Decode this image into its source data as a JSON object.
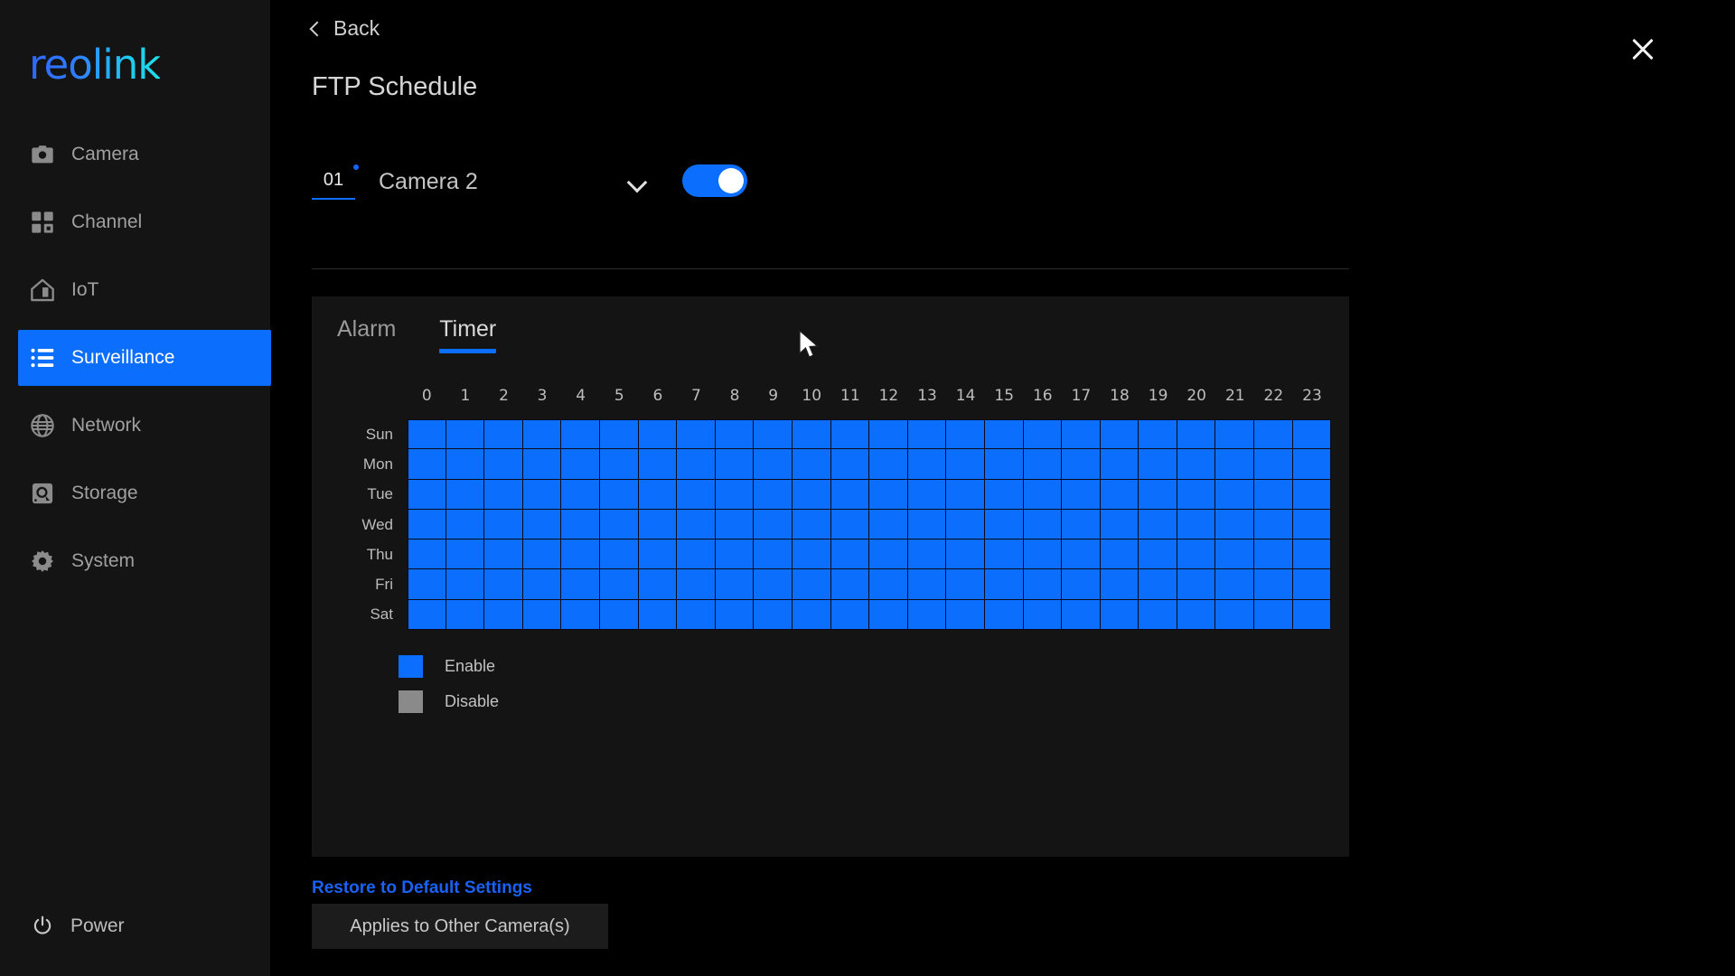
{
  "brand": {
    "logo_text": "reolink"
  },
  "sidebar": {
    "items": [
      {
        "label": "Camera",
        "icon": "camera-icon",
        "active": false
      },
      {
        "label": "Channel",
        "icon": "grid-icon",
        "active": false
      },
      {
        "label": "IoT",
        "icon": "home-icon",
        "active": false
      },
      {
        "label": "Surveillance",
        "icon": "list-icon",
        "active": true
      },
      {
        "label": "Network",
        "icon": "globe-icon",
        "active": false
      },
      {
        "label": "Storage",
        "icon": "hard-drive-icon",
        "active": false
      },
      {
        "label": "System",
        "icon": "gear-icon",
        "active": false
      }
    ],
    "power": {
      "label": "Power",
      "icon": "power-icon"
    }
  },
  "header": {
    "back_label": "Back",
    "back_icon": "chevron-left-icon",
    "title": "FTP Schedule",
    "close_icon": "close-icon"
  },
  "camera_selector": {
    "index": "01",
    "name": "Camera 2",
    "caret_icon": "chevron-down-icon",
    "enabled": true
  },
  "panel": {
    "tabs": [
      {
        "label": "Alarm",
        "active": false
      },
      {
        "label": "Timer",
        "active": true
      }
    ]
  },
  "schedule": {
    "hours": [
      "0",
      "1",
      "2",
      "3",
      "4",
      "5",
      "6",
      "7",
      "8",
      "9",
      "10",
      "11",
      "12",
      "13",
      "14",
      "15",
      "16",
      "17",
      "18",
      "19",
      "20",
      "21",
      "22",
      "23"
    ],
    "days": [
      "Sun",
      "Mon",
      "Tue",
      "Wed",
      "Thu",
      "Fri",
      "Sat"
    ],
    "cells": [
      [
        1,
        1,
        1,
        1,
        1,
        1,
        1,
        1,
        1,
        1,
        1,
        1,
        1,
        1,
        1,
        1,
        1,
        1,
        1,
        1,
        1,
        1,
        1,
        1
      ],
      [
        1,
        1,
        1,
        1,
        1,
        1,
        1,
        1,
        1,
        1,
        1,
        1,
        1,
        1,
        1,
        1,
        1,
        1,
        1,
        1,
        1,
        1,
        1,
        1
      ],
      [
        1,
        1,
        1,
        1,
        1,
        1,
        1,
        1,
        1,
        1,
        1,
        1,
        1,
        1,
        1,
        1,
        1,
        1,
        1,
        1,
        1,
        1,
        1,
        1
      ],
      [
        1,
        1,
        1,
        1,
        1,
        1,
        1,
        1,
        1,
        1,
        1,
        1,
        1,
        1,
        1,
        1,
        1,
        1,
        1,
        1,
        1,
        1,
        1,
        1
      ],
      [
        1,
        1,
        1,
        1,
        1,
        1,
        1,
        1,
        1,
        1,
        1,
        1,
        1,
        1,
        1,
        1,
        1,
        1,
        1,
        1,
        1,
        1,
        1,
        1
      ],
      [
        1,
        1,
        1,
        1,
        1,
        1,
        1,
        1,
        1,
        1,
        1,
        1,
        1,
        1,
        1,
        1,
        1,
        1,
        1,
        1,
        1,
        1,
        1,
        1
      ],
      [
        1,
        1,
        1,
        1,
        1,
        1,
        1,
        1,
        1,
        1,
        1,
        1,
        1,
        1,
        1,
        1,
        1,
        1,
        1,
        1,
        1,
        1,
        1,
        1
      ]
    ],
    "legend": [
      {
        "label": "Enable",
        "state": "on"
      },
      {
        "label": "Disable",
        "state": "off"
      }
    ]
  },
  "footer": {
    "restore_label": "Restore to Default Settings",
    "apply_label": "Applies to Other Camera(s)"
  },
  "colors": {
    "accent_blue": "#0b6efd",
    "enable": "#0b6efd",
    "disable": "#8a8a8a",
    "link_blue": "#1a62f5",
    "sidebar_bg": "#141414",
    "panel_bg": "#141414",
    "page_bg": "#000000"
  }
}
